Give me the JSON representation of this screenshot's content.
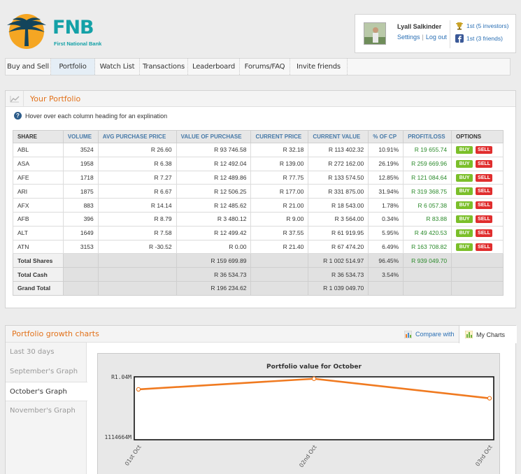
{
  "brand": {
    "name": "FNB",
    "subtitle": "First National Bank"
  },
  "user": {
    "name": "Lyall Salkinder",
    "settings_label": "Settings",
    "logout_label": "Log out",
    "rank_investors": "1st (5 investors)",
    "rank_friends": "1st (3 friends)"
  },
  "nav": {
    "tabs": [
      {
        "label": "Buy and Sell"
      },
      {
        "label": "Portfolio"
      },
      {
        "label": "Watch List"
      },
      {
        "label": "Transactions"
      },
      {
        "label": "Leaderboard"
      },
      {
        "label": "Forums/FAQ"
      },
      {
        "label": "Invite friends"
      }
    ],
    "active": "Portfolio"
  },
  "portfolio": {
    "title": "Your Portfolio",
    "hint": "Hover over each column heading for an explination",
    "columns": [
      "SHARE",
      "VOLUME",
      "AVG PURCHASE PRICE",
      "VALUE OF PURCHASE",
      "CURRENT PRICE",
      "CURRENT VALUE",
      "% OF CP",
      "PROFIT/LOSS",
      "OPTIONS"
    ],
    "buy_label": "BUY",
    "sell_label": "SELL",
    "rows": [
      {
        "share": "ABL",
        "volume": "3524",
        "avg": "R 26.60",
        "vop": "R 93 746.58",
        "cp": "R 32.18",
        "cv": "R 113 402.32",
        "pct": "10.91%",
        "pl": "R 19 655.74"
      },
      {
        "share": "ASA",
        "volume": "1958",
        "avg": "R 6.38",
        "vop": "R 12 492.04",
        "cp": "R 139.00",
        "cv": "R 272 162.00",
        "pct": "26.19%",
        "pl": "R 259 669.96"
      },
      {
        "share": "AFE",
        "volume": "1718",
        "avg": "R 7.27",
        "vop": "R 12 489.86",
        "cp": "R 77.75",
        "cv": "R 133 574.50",
        "pct": "12.85%",
        "pl": "R 121 084.64"
      },
      {
        "share": "ARI",
        "volume": "1875",
        "avg": "R 6.67",
        "vop": "R 12 506.25",
        "cp": "R 177.00",
        "cv": "R 331 875.00",
        "pct": "31.94%",
        "pl": "R 319 368.75"
      },
      {
        "share": "AFX",
        "volume": "883",
        "avg": "R 14.14",
        "vop": "R 12 485.62",
        "cp": "R 21.00",
        "cv": "R 18 543.00",
        "pct": "1.78%",
        "pl": "R 6 057.38"
      },
      {
        "share": "AFB",
        "volume": "396",
        "avg": "R 8.79",
        "vop": "R 3 480.12",
        "cp": "R 9.00",
        "cv": "R 3 564.00",
        "pct": "0.34%",
        "pl": "R 83.88"
      },
      {
        "share": "ALT",
        "volume": "1649",
        "avg": "R 7.58",
        "vop": "R 12 499.42",
        "cp": "R 37.55",
        "cv": "R 61 919.95",
        "pct": "5.95%",
        "pl": "R 49 420.53"
      },
      {
        "share": "ATN",
        "volume": "3153",
        "avg": "R -30.52",
        "vop": "R 0.00",
        "cp": "R 21.40",
        "cv": "R 67 474.20",
        "pct": "6.49%",
        "pl": "R 163 708.82"
      }
    ],
    "totals": [
      {
        "label": "Total Shares",
        "vop": "R 159 699.89",
        "cv": "R 1 002 514.97",
        "pct": "96.45%",
        "pl": "R 939 049.70"
      },
      {
        "label": "Total Cash",
        "vop": "R 36 534.73",
        "cv": "R 36 534.73",
        "pct": "3.54%",
        "pl": ""
      },
      {
        "label": "Grand Total",
        "vop": "R 196 234.62",
        "cv": "R 1 039 049.70",
        "pct": "",
        "pl": ""
      }
    ]
  },
  "growth": {
    "title": "Portfolio growth charts",
    "compare_label": "Compare with",
    "mycharts_label": "My Charts",
    "side_items": [
      {
        "label": "Last 30 days"
      },
      {
        "label": "September's Graph"
      },
      {
        "label": "October's Graph"
      },
      {
        "label": "November's Graph"
      }
    ],
    "active_side": "October's Graph"
  },
  "chart_data": {
    "type": "line",
    "title": "Portfolio value for October",
    "categories": [
      "01st Oct",
      "02nd Oct",
      "03rd Oct"
    ],
    "series": [
      {
        "values": [
          1020000,
          1039049.7,
          1004000
        ]
      }
    ],
    "y_tick_labels": [
      "R1.04M",
      "1114664M"
    ],
    "ylim": [
      932000,
      1040000
    ],
    "line_color": "#f07a20",
    "grid": false
  }
}
